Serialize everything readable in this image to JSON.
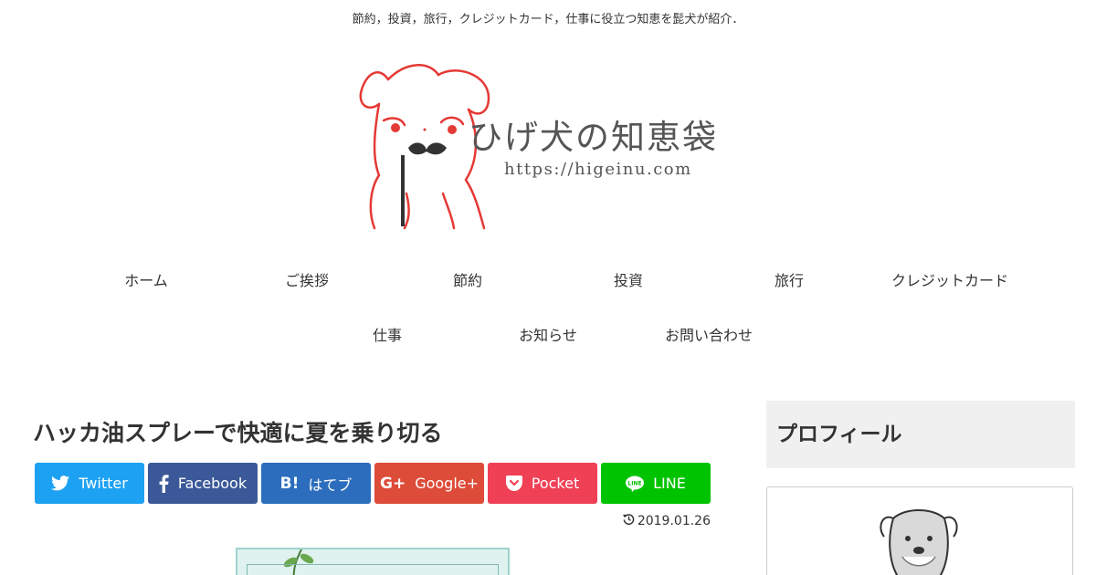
{
  "site": {
    "tagline": "節約，投資，旅行，クレジットカード，仕事に役立つ知恵を髭犬が紹介．",
    "logo_title": "ひげ犬の知恵袋",
    "logo_url": "https://higeinu.com"
  },
  "nav": {
    "row1": [
      {
        "label": "ホーム"
      },
      {
        "label": "ご挨拶"
      },
      {
        "label": "節約"
      },
      {
        "label": "投資"
      },
      {
        "label": "旅行"
      },
      {
        "label": "クレジットカード"
      }
    ],
    "row2": [
      {
        "label": "仕事"
      },
      {
        "label": "お知らせ"
      },
      {
        "label": "お問い合わせ"
      }
    ]
  },
  "article": {
    "title": "ハッカ油スプレーで快適に夏を乗り切る",
    "updated_date": "2019.01.26",
    "share": [
      {
        "label": "Twitter",
        "color": "#1da1f2",
        "icon": "twitter-icon"
      },
      {
        "label": "Facebook",
        "color": "#3b5998",
        "icon": "facebook-icon"
      },
      {
        "label": "はてブ",
        "color": "#2c6ebd",
        "icon": "hatena-icon"
      },
      {
        "label": "Google+",
        "color": "#dd4b39",
        "icon": "google-plus-icon"
      },
      {
        "label": "Pocket",
        "color": "#ef4056",
        "icon": "pocket-icon"
      },
      {
        "label": "LINE",
        "color": "#00c300",
        "icon": "line-icon"
      }
    ]
  },
  "sidebar": {
    "profile_title": "プロフィール"
  },
  "colors": {
    "logo_red": "#e53935",
    "text": "#333333",
    "widget_bg": "#f0f0f0"
  }
}
